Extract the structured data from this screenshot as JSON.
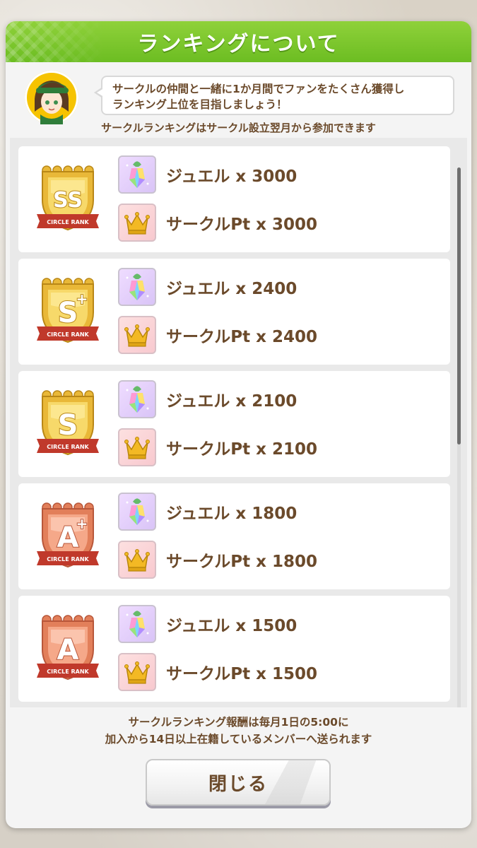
{
  "dialog": {
    "title": "ランキングについて",
    "speech_line1": "サークルの仲間と一緒に1か月間でファンをたくさん獲得し",
    "speech_line2": "ランキング上位を目指しましょう！",
    "note": "サークルランキングはサークル設立翌月から参加できます"
  },
  "ranks": [
    {
      "rank": "SS",
      "plus": false,
      "tier": "gold",
      "rank_caption": "CIRCLE RANK",
      "jewel": "ジュエル x 3000",
      "circle_pt": "サークルPt x 3000"
    },
    {
      "rank": "S",
      "plus": true,
      "tier": "gold",
      "rank_caption": "CIRCLE RANK",
      "jewel": "ジュエル x 2400",
      "circle_pt": "サークルPt x 2400"
    },
    {
      "rank": "S",
      "plus": false,
      "tier": "gold",
      "rank_caption": "CIRCLE RANK",
      "jewel": "ジュエル x 2100",
      "circle_pt": "サークルPt x 2100"
    },
    {
      "rank": "A",
      "plus": true,
      "tier": "copper",
      "rank_caption": "CIRCLE RANK",
      "jewel": "ジュエル x 1800",
      "circle_pt": "サークルPt x 1800"
    },
    {
      "rank": "A",
      "plus": false,
      "tier": "copper",
      "rank_caption": "CIRCLE RANK",
      "jewel": "ジュエル x 1500",
      "circle_pt": "サークルPt x 1500"
    }
  ],
  "footer": {
    "line1": "サークルランキング報酬は毎月1日の5:00に",
    "line2": "加入から14日以上在籍しているメンバーへ送られます"
  },
  "close_button": {
    "label": "閉じる"
  },
  "colors": {
    "header_green": "#7ac62c",
    "text_brown": "#6b4a2b",
    "gold": "#e8b830",
    "copper": "#e07a55"
  },
  "icons": {
    "jewel": "jewel-icon",
    "crown": "crown-icon",
    "badge": "circle-rank-badge-icon"
  }
}
